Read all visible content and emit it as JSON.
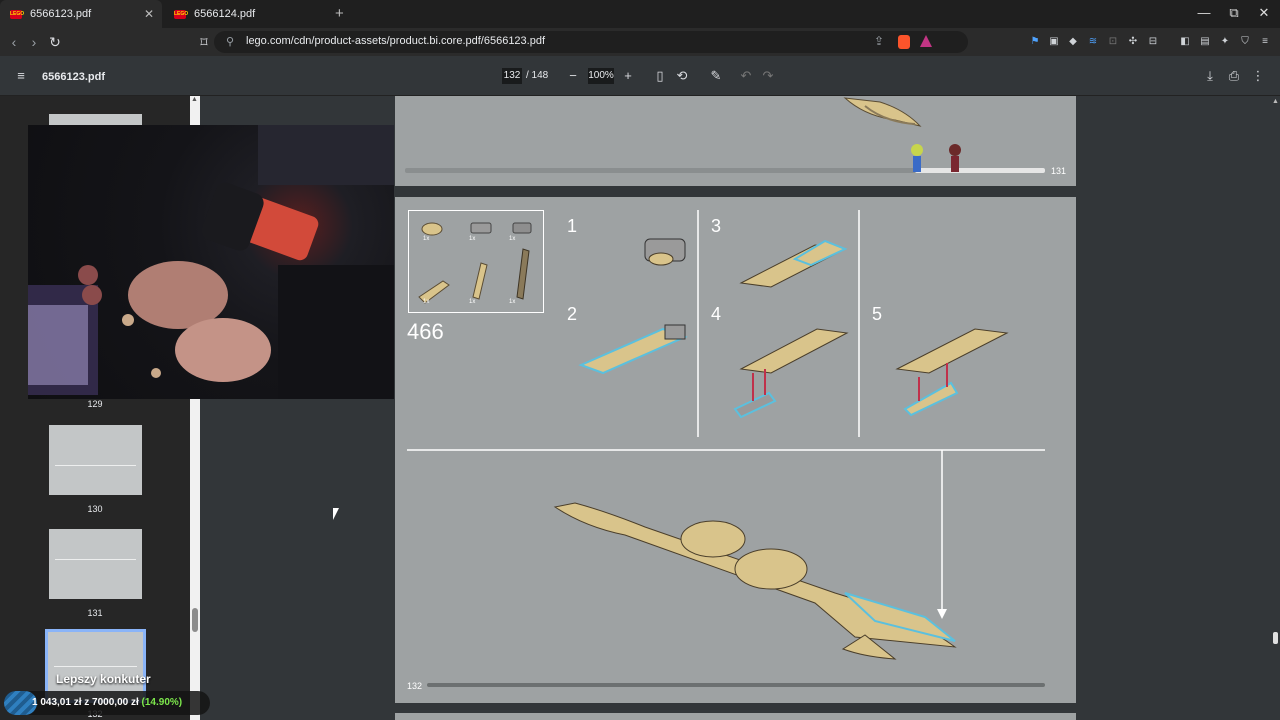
{
  "tabs": [
    {
      "title": "6566123.pdf",
      "active": true
    },
    {
      "title": "6566124.pdf",
      "active": false
    }
  ],
  "new_tab": "+",
  "window_controls": {
    "minimize": "—",
    "restore": "⧉",
    "close": "✕"
  },
  "address": {
    "url": "lego.com/cdn/product-assets/product.bi.core.pdf/6566123.pdf"
  },
  "pdf_toolbar": {
    "file_name": "6566123.pdf",
    "current_page": "132",
    "total_pages": "/ 148",
    "zoom": "100%"
  },
  "thumbnails": [
    {
      "label": "129"
    },
    {
      "label": "130"
    },
    {
      "label": "131"
    },
    {
      "label": "132"
    }
  ],
  "page131": {
    "number": "131"
  },
  "page132": {
    "set_number": "466",
    "number": "132",
    "part_counts": [
      "1x",
      "1x",
      "1x",
      "1x",
      "1x",
      "1x"
    ],
    "steps": [
      "1",
      "2",
      "3",
      "4",
      "5"
    ]
  },
  "overlay": {
    "title": "Lepszy konkuter",
    "amount": "1 043,01 zł z 7000,00 zł",
    "percent": "(14.90%)",
    "progress_fraction": 0.149
  },
  "colors": {
    "page_bg": "#9ea2a3",
    "brick_tan": "#d9c48b",
    "brick_dark_tan": "#8a7a5a",
    "highlight_blue": "#5bc0de",
    "arrow_red": "#c0304a"
  }
}
